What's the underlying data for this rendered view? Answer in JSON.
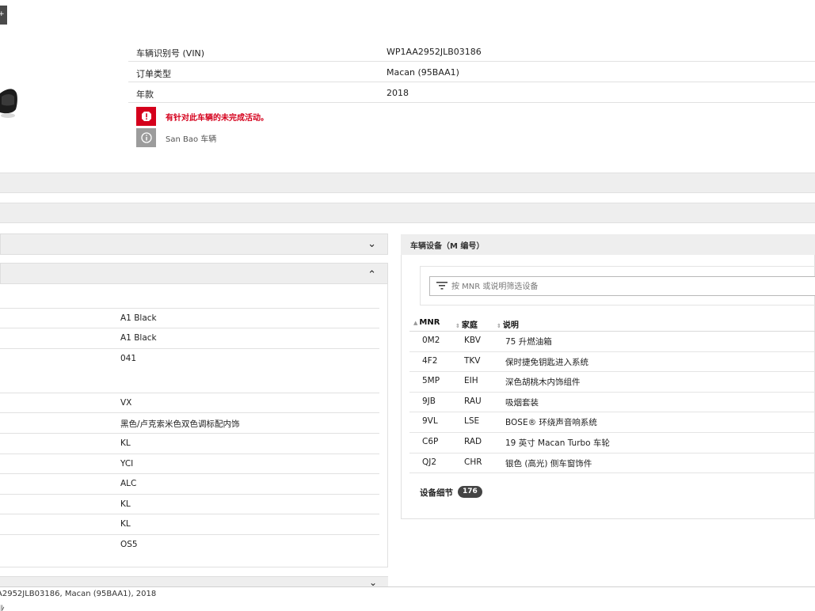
{
  "corner_button": {
    "label": "+"
  },
  "vehicle_info": [
    {
      "label": "车辆识别号 (VIN)",
      "value": "WP1AA2952JLB03186"
    },
    {
      "label": "订单类型",
      "value": "Macan (95BAA1)"
    },
    {
      "label": "年款",
      "value": "2018"
    }
  ],
  "alerts": {
    "open_activity": "有针对此车辆的未完成活动。",
    "vehicle_note": "San Bao 车辆"
  },
  "left_rows": [
    {
      "value": "A1 Black"
    },
    {
      "value": "A1 Black"
    },
    {
      "value": "041"
    },
    {
      "value": "VX"
    },
    {
      "value": "黑色/卢克索米色双色调标配内饰"
    },
    {
      "value": "KL"
    },
    {
      "value": "YCI"
    },
    {
      "value": "ALC"
    },
    {
      "value": "KL"
    },
    {
      "value": "KL"
    },
    {
      "value": "OS5"
    }
  ],
  "equipment": {
    "title": "车辆设备（M 编号）",
    "filter_placeholder": "按 MNR 或说明筛选设备",
    "columns": [
      "MNR",
      "家庭",
      "说明"
    ],
    "rows": [
      {
        "mnr": "0M2",
        "family": "KBV",
        "desc": "75 升燃油箱"
      },
      {
        "mnr": "4F2",
        "family": "TKV",
        "desc": "保时捷免钥匙进入系统"
      },
      {
        "mnr": "5MP",
        "family": "EIH",
        "desc": "深色胡桃木内饰组件"
      },
      {
        "mnr": "9JB",
        "family": "RAU",
        "desc": "吸烟套装"
      },
      {
        "mnr": "9VL",
        "family": "LSE",
        "desc": "BOSE® 环绕声音响系统"
      },
      {
        "mnr": "C6P",
        "family": "RAD",
        "desc": "19 英寸 Macan Turbo 车轮"
      },
      {
        "mnr": "QJ2",
        "family": "CHR",
        "desc": "银色 (高光) 侧车窗饰件"
      }
    ],
    "detail_label": "设备细节",
    "detail_count": "176"
  },
  "footer": {
    "line1": "A2952JLB03186, Macan (95BAA1), 2018",
    "line2": "业"
  },
  "colors": {
    "alert_red": "#d5001c",
    "info_grey": "#9c9c9c",
    "panel_grey": "#eeeeee"
  }
}
